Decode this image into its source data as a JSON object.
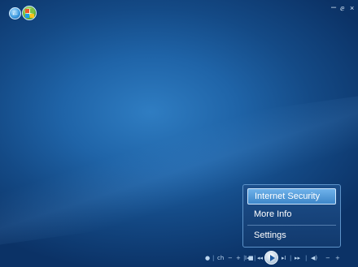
{
  "window": {
    "minimize_glyph": "–",
    "restore_glyph": "ⅇ",
    "close_glyph": "×"
  },
  "nav": {
    "back_icon": "back-arrow-icon",
    "start_icon": "windows-start-orb-icon"
  },
  "menu": {
    "items": [
      {
        "label": "Internet Security",
        "selected": true
      },
      {
        "label": "More Info",
        "selected": false
      },
      {
        "label": "Settings",
        "selected": false
      }
    ]
  },
  "transport": {
    "record": "●",
    "channel_label": "ch",
    "channel_down": "−",
    "channel_up": "+",
    "stop": "■",
    "rewind": "◂◂",
    "skip_back": "I◂",
    "skip_forward": "▸I",
    "fast_forward": "▸▸",
    "mute": "◀)",
    "volume_down": "−",
    "volume_up": "+",
    "separator": "|"
  },
  "colors": {
    "background": "#1f64a8",
    "menu_highlight": "#3d86c9",
    "menu_border": "#5d93c9"
  }
}
